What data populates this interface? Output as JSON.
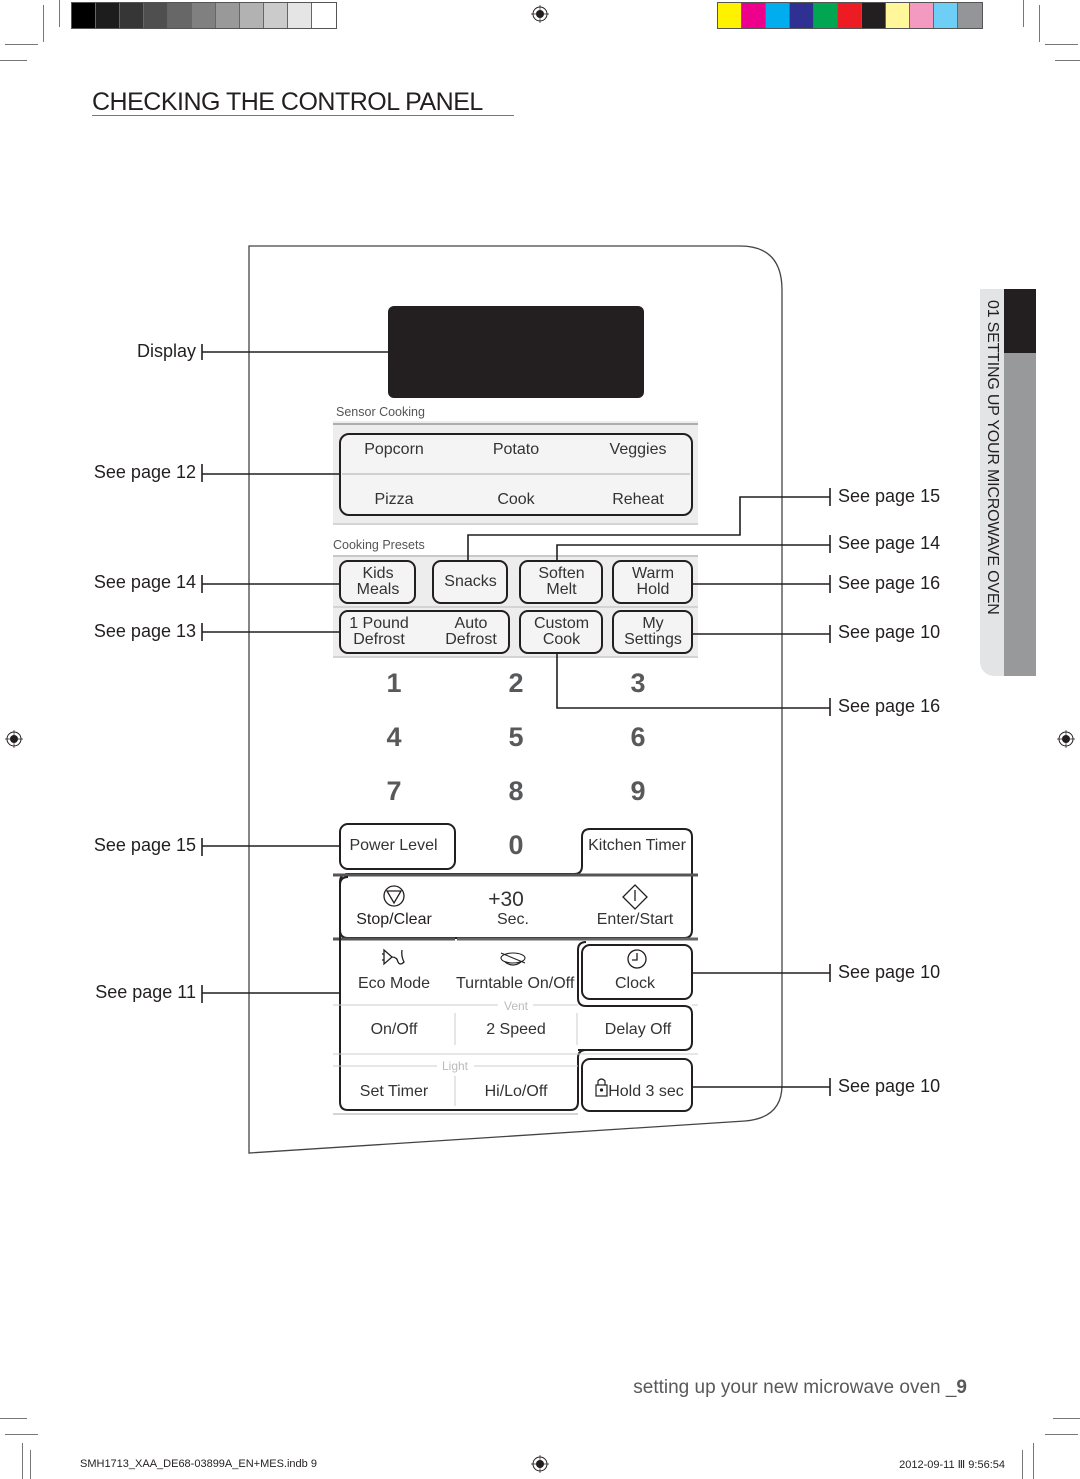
{
  "print_marks": {
    "grayscale_swatches": [
      "#000000",
      "#1d1d1d",
      "#363636",
      "#4f4f4f",
      "#676767",
      "#808080",
      "#999999",
      "#b2b2b2",
      "#cbcbcb",
      "#e5e5e5",
      "#ffffff"
    ],
    "color_swatches": [
      "#fff200",
      "#ec008c",
      "#00aeef",
      "#2e3192",
      "#00a651",
      "#ed1c24",
      "#231f20",
      "#fff799",
      "#f49ac1",
      "#6dcff6",
      "#939598"
    ]
  },
  "page": {
    "title": "CHECKING THE CONTROL PANEL",
    "side_tab": "01 SETTING UP YOUR MICROWAVE OVEN",
    "footer_section": "setting up your new microwave oven _",
    "page_number": "9",
    "slug_file": "SMH1713_XAA_DE68-03899A_EN+MES.indb   9",
    "slug_date": "2012-09-11   Ⅲ 9:56:54"
  },
  "callouts_left": [
    {
      "label": "Display"
    },
    {
      "label": "See page 12"
    },
    {
      "label": "See page 14"
    },
    {
      "label": "See page 13"
    },
    {
      "label": "See page 15"
    },
    {
      "label": "See page 11"
    }
  ],
  "callouts_right": [
    {
      "label": "See page 15"
    },
    {
      "label": "See page 14"
    },
    {
      "label": "See page 16"
    },
    {
      "label": "See page 10"
    },
    {
      "label": "See page 16"
    },
    {
      "label": "See page 10"
    },
    {
      "label": "See page 10"
    }
  ],
  "panel": {
    "sensor_cooking_label": "Sensor Cooking",
    "sensor_keys": [
      "Popcorn",
      "Potato",
      "Veggies",
      "Pizza",
      "Cook",
      "Reheat"
    ],
    "cooking_presets_label": "Cooking Presets",
    "preset_keys": {
      "kids_meals": [
        "Kids",
        "Meals"
      ],
      "snacks": "Snacks",
      "soften_melt": [
        "Soften",
        "Melt"
      ],
      "warm_hold": [
        "Warm",
        "Hold"
      ],
      "pound_defrost": [
        "1 Pound",
        "Defrost"
      ],
      "auto_defrost": [
        "Auto",
        "Defrost"
      ],
      "custom_cook": [
        "Custom",
        "Cook"
      ],
      "my_settings": [
        "My",
        "Settings"
      ]
    },
    "digits": [
      "1",
      "2",
      "3",
      "4",
      "5",
      "6",
      "7",
      "8",
      "9",
      "0"
    ],
    "power_level": "Power Level",
    "kitchen_timer": "Kitchen Timer",
    "stop_clear": "Stop/Clear",
    "plus30": "+30",
    "plus30_sub": "Sec.",
    "enter_start": "Enter/Start",
    "eco_mode": "Eco Mode",
    "turntable": "Turntable On/Off",
    "clock": "Clock",
    "vent_label": "Vent",
    "vent_keys": [
      "On/Off",
      "2 Speed",
      "Delay Off"
    ],
    "light_label": "Light",
    "light_keys": [
      "Set Timer",
      "Hi/Lo/Off"
    ],
    "hold": "Hold 3 sec"
  }
}
